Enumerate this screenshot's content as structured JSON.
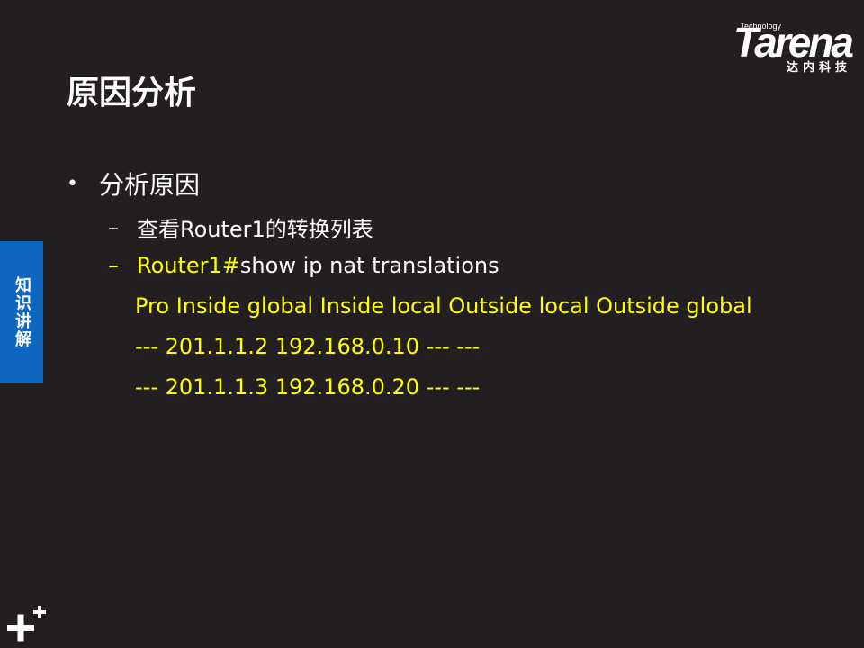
{
  "logo": {
    "tag": "Technology",
    "wordmark": "Tarena",
    "chinese": "达内科技"
  },
  "slide": {
    "title": "原因分析",
    "side_tab": "知识讲解",
    "bullet": "分析原因",
    "sub_items": [
      {
        "text": "查看Router1的转换列表"
      },
      {
        "prefix": "Router1#",
        "text": "show ip nat translations"
      }
    ],
    "code_lines": [
      "Pro Inside global Inside local Outside local Outside global",
      "--- 201.1.1.2 192.168.0.10 --- ---",
      "--- 201.1.1.3 192.168.0.20 --- ---"
    ]
  },
  "icons": {
    "corner": "plus-icon"
  },
  "colors": {
    "background": "#231f20",
    "accent_blue": "#0f66bf",
    "highlight_yellow": "#ffff00",
    "text": "#ffffff"
  }
}
